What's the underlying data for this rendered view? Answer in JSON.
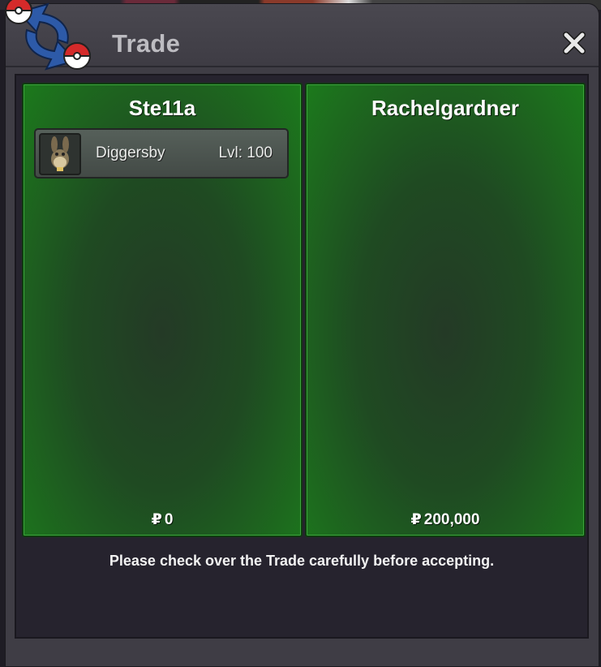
{
  "window": {
    "title": "Trade"
  },
  "left_party": {
    "name": "Ste11a",
    "money_symbol": "₽",
    "money": "0",
    "pokemon": [
      {
        "name": "Diggersby",
        "level": "Lvl: 100"
      }
    ]
  },
  "right_party": {
    "name": "Rachelgardner",
    "money_symbol": "₽",
    "money": "200,000"
  },
  "notice": "Please check over the Trade carefully before accepting.",
  "icons": {
    "logo": "trade-arrows-pokeball-icon",
    "close": "close-icon",
    "pokemon": "diggersby-sprite-icon"
  },
  "colors": {
    "panel_green": "#1c7a1c",
    "title_text": "#bdbcc1",
    "window_bg": "#3f3d45"
  }
}
